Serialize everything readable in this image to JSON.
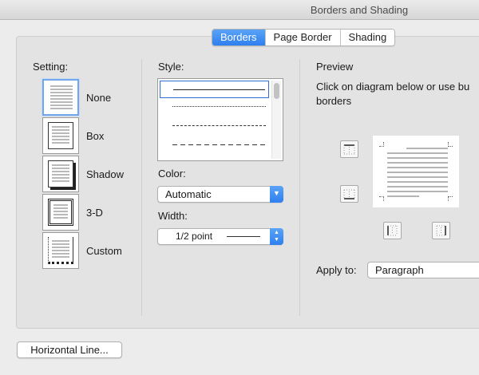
{
  "window": {
    "title": "Borders and Shading"
  },
  "tabs": [
    {
      "label": "Borders",
      "active": true
    },
    {
      "label": "Page Border",
      "active": false
    },
    {
      "label": "Shading",
      "active": false
    }
  ],
  "setting": {
    "heading": "Setting:",
    "options": [
      {
        "label": "None",
        "selected": true
      },
      {
        "label": "Box",
        "selected": false
      },
      {
        "label": "Shadow",
        "selected": false
      },
      {
        "label": "3-D",
        "selected": false
      },
      {
        "label": "Custom",
        "selected": false
      }
    ]
  },
  "style": {
    "heading": "Style:",
    "line_styles": [
      "solid",
      "dotted",
      "dashed",
      "long-dashed"
    ],
    "selected_style": "solid"
  },
  "color": {
    "label": "Color:",
    "value": "Automatic"
  },
  "width": {
    "label": "Width:",
    "value": "1/2 point"
  },
  "preview": {
    "heading": "Preview",
    "instruction_line1": "Click on diagram below or use bu",
    "instruction_line2": "borders"
  },
  "apply_to": {
    "label": "Apply to:",
    "value": "Paragraph"
  },
  "footer": {
    "horizontal_line_button": "Horizontal Line..."
  },
  "colors": {
    "accent": "#2e7ff0",
    "selection": "#72a7ea"
  },
  "icons": [
    "top-border-icon",
    "bottom-border-icon",
    "left-border-icon",
    "right-border-icon",
    "chevron-down-icon",
    "stepper-icon"
  ]
}
